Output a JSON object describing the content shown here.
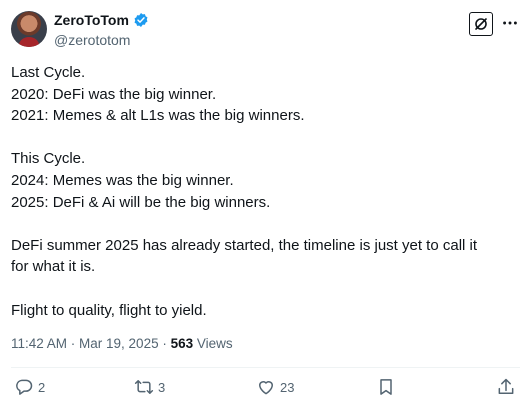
{
  "author": {
    "display_name": "ZeroToTom",
    "handle": "@zerototom",
    "verified": true
  },
  "tweet": {
    "lines": [
      "Last Cycle.",
      "2020: DeFi was the big winner.",
      "2021: Memes & alt L1s was the big winners.",
      "",
      "This Cycle.",
      "2024: Memes was the big winner.",
      "2025: DeFi & Ai will be the big winners.",
      "",
      "DeFi summer 2025 has already started, the timeline is just yet to call it",
      "for what it is.",
      "",
      "Flight to quality, flight to yield."
    ]
  },
  "meta": {
    "timestamp": "11:42 AM · Mar 19, 2025 · ",
    "views_count": "563",
    "views_label": " Views"
  },
  "actions": {
    "replies": "2",
    "reposts": "3",
    "likes": "23"
  },
  "colors": {
    "text": "#0f1419",
    "secondary": "#536471",
    "verified": "#1d9bf0",
    "divider": "#eff3f4"
  },
  "icons": [
    "verified-badge-icon",
    "grok-icon",
    "more-icon",
    "reply-icon",
    "repost-icon",
    "like-icon",
    "bookmark-icon",
    "share-icon"
  ]
}
